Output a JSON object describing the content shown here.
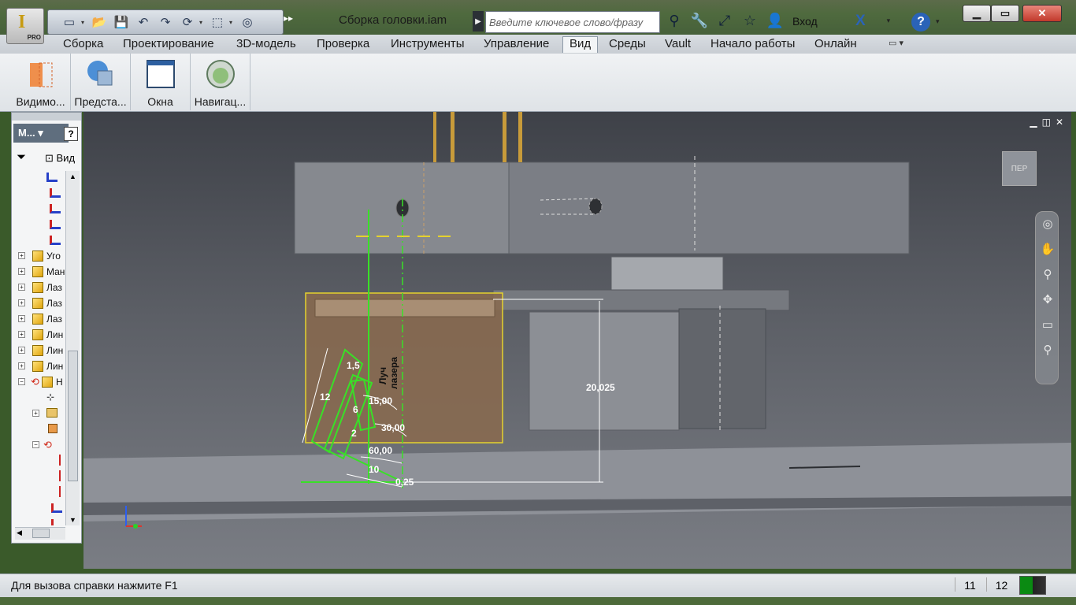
{
  "window": {
    "doc_title": "Сборка головки.iam",
    "search_placeholder": "Введите ключевое слово/фразу",
    "login_label": "Вход",
    "app_badge": "PRO",
    "minimize_glyph": "▁",
    "maximize_glyph": "▭",
    "close_glyph": "✕",
    "help_glyph": "?",
    "x_glyph": "X"
  },
  "ribbon": {
    "tabs": [
      "Сборка",
      "Проектирование",
      "3D-модель",
      "Проверка",
      "Инструменты",
      "Управление",
      "Вид",
      "Среды",
      "Vault",
      "Начало работы",
      "Онлайн"
    ],
    "active_tab": "Вид",
    "panel_buttons": [
      "Видимо...",
      "Предста...",
      "Окна",
      "Навигац..."
    ]
  },
  "browser": {
    "model_label": "М...",
    "view_label": "Вид",
    "tree_labels": [
      "Уго",
      "Ман",
      "Лаз",
      "Лаз",
      "Лаз",
      "Лин",
      "Лин",
      "Лин",
      "Н"
    ]
  },
  "viewport": {
    "window_controls": [
      "▁",
      "◫",
      "✕"
    ],
    "viewcube_label": "ПЕР",
    "sketch_labels": {
      "dim_20025": "20,025",
      "dim_15": "15,00",
      "dim_30": "30,00",
      "dim_60": "60,00",
      "dim_12": "12",
      "dim_6": "6",
      "dim_1_5": "1,5",
      "dim_2": "2",
      "dim_10": "10",
      "dim_0_25": "0,25",
      "laser_line1": "Луч",
      "laser_line2": "лазера"
    },
    "colors": {
      "sketch_green": "#39e027",
      "highlight_yellow": "#e4d22e",
      "part_brown": "#8a6a4e"
    }
  },
  "status": {
    "help_text": "Для вызова справки нажмите F1",
    "count_a": "11",
    "count_b": "12"
  }
}
